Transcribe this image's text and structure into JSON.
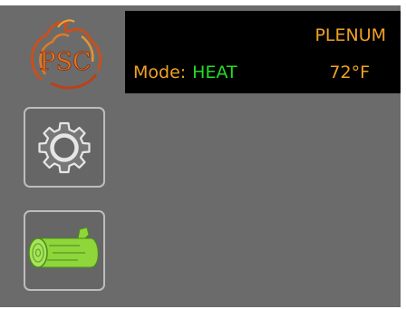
{
  "logo": {
    "text": "PSC",
    "icon": "psc-flame-logo"
  },
  "status": {
    "mode_label": "Mode:",
    "mode_value": "HEAT",
    "sensor_label": "PLENUM",
    "temperature": "72°F"
  },
  "buttons": {
    "settings_icon": "gear-icon",
    "fuel_icon": "log-icon"
  },
  "colors": {
    "background": "#6b6b6b",
    "panel": "#000000",
    "label": "#f0a024",
    "mode_active": "#22dd22",
    "log_green": "#8ed63a"
  }
}
